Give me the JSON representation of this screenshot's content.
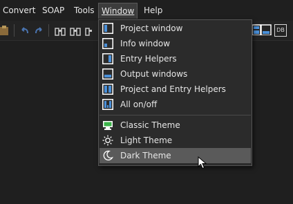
{
  "menubar": {
    "items": [
      {
        "label": "Convert"
      },
      {
        "label": "SOAP"
      },
      {
        "label": "Tools"
      },
      {
        "label": "Window"
      },
      {
        "label": "Help"
      }
    ]
  },
  "dropdown": {
    "items": [
      {
        "label": "Project window",
        "icon": "project-window-icon"
      },
      {
        "label": "Info window",
        "icon": "info-window-icon"
      },
      {
        "label": "Entry Helpers",
        "icon": "entry-helpers-icon"
      },
      {
        "label": "Output windows",
        "icon": "output-windows-icon"
      },
      {
        "label": "Project and Entry Helpers",
        "icon": "project-entry-helpers-icon"
      },
      {
        "label": "All on/off",
        "icon": "all-on-off-icon"
      },
      {
        "label": "Classic Theme",
        "icon": "classic-theme-icon"
      },
      {
        "label": "Light Theme",
        "icon": "sun-icon"
      },
      {
        "label": "Dark Theme",
        "icon": "moon-icon"
      }
    ]
  },
  "toolbar": {
    "db_label": "DB"
  },
  "colors": {
    "background": "#1f1f1f",
    "menu_bg": "#2b2b2b",
    "hover": "#5a5a5a",
    "icon_blue": "#4a90d9"
  }
}
